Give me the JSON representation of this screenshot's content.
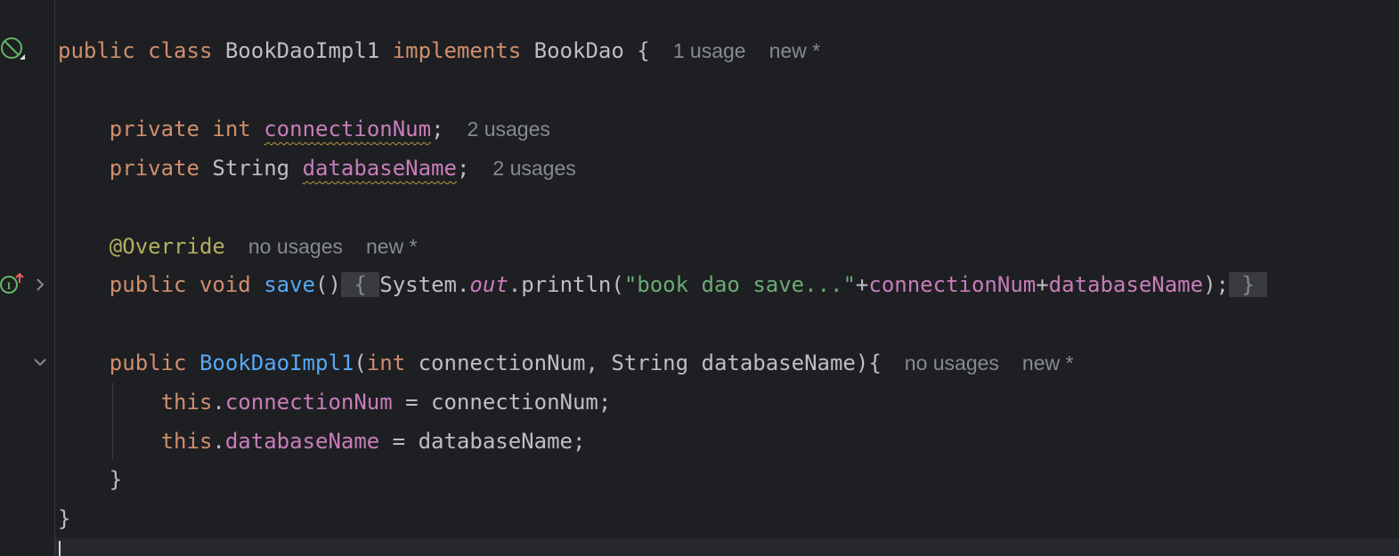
{
  "code": {
    "line1": {
      "public": "public",
      "class": "class",
      "name": "BookDaoImpl1",
      "implements": "implements",
      "iface": "BookDao",
      "brace": "{",
      "hint1": "1 usage",
      "hint2": "new *"
    },
    "line2": {
      "private": "private",
      "type": "int",
      "field": "connectionNum",
      "semi": ";",
      "hint1": "2 usages"
    },
    "line3": {
      "private": "private",
      "type": "String",
      "field": "databaseName",
      "semi": ";",
      "hint1": "2 usages"
    },
    "line4": {
      "annotation": "@Override",
      "hint1": "no usages",
      "hint2": "new *"
    },
    "line5": {
      "public": "public",
      "void": "void",
      "method": "save",
      "parens": "()",
      "open": "{",
      "sys": "System.",
      "out": "out",
      "println": ".println(",
      "str": "\"book dao save...\"",
      "plus1": "+",
      "f1": "connectionNum",
      "plus2": "+",
      "f2": "databaseName",
      "end": ");",
      "close": "}"
    },
    "line6": {
      "public": "public",
      "ctor": "BookDaoImpl1",
      "lp": "(",
      "int": "int",
      "p1": " connectionNum, String databaseName){",
      "hint1": "no usages",
      "hint2": "new *"
    },
    "line7": {
      "this": "this",
      "dot": ".",
      "field": "connectionNum",
      "rest": " = connectionNum;"
    },
    "line8": {
      "this": "this",
      "dot": ".",
      "field": "databaseName",
      "rest": " = databaseName;"
    },
    "line9": {
      "brace": "}"
    },
    "line10": {
      "brace": "}"
    }
  },
  "gutter_icons": [
    "no-run-icon",
    "implements-up-icon",
    "expand-chevron-icon",
    "collapse-chevron-icon"
  ]
}
